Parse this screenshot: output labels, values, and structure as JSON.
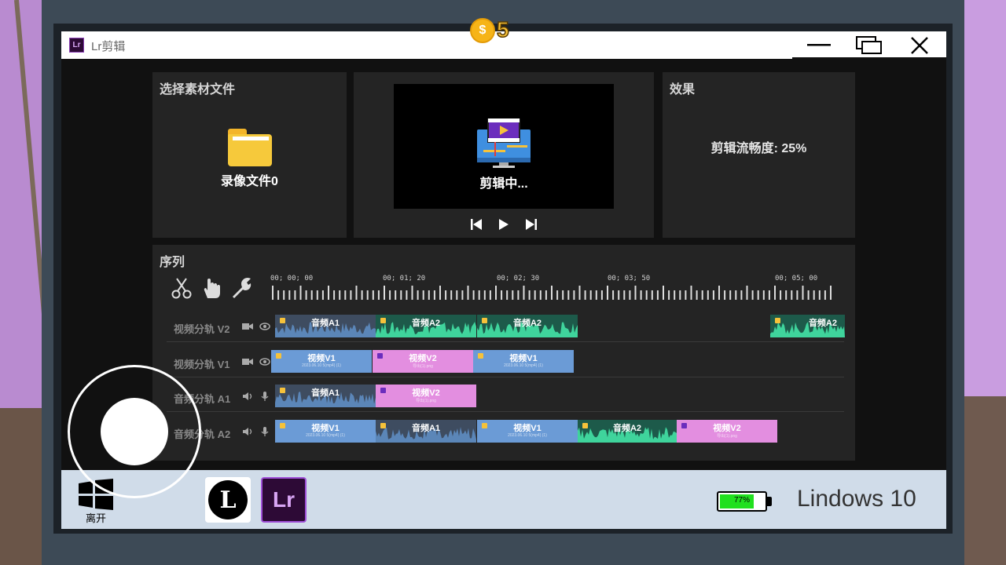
{
  "coin": {
    "count": "5",
    "symbol": "$"
  },
  "window": {
    "title": "Lr剪辑",
    "icon_text": "Lr",
    "controls": [
      "minimize-icon",
      "restore-icon",
      "close-icon"
    ]
  },
  "files_panel": {
    "title": "选择素材文件",
    "item_label": "录像文件0",
    "icon": "folder-icon"
  },
  "preview_panel": {
    "status": "剪辑中...",
    "icon": "editing-monitor-icon",
    "controls": [
      "skip-back-icon",
      "play-icon",
      "skip-forward-icon"
    ]
  },
  "effect_panel": {
    "title": "效果",
    "smoothness": "剪辑流畅度: 25%"
  },
  "sequence": {
    "title": "序列",
    "tools": [
      "scissors-icon",
      "hand-icon",
      "wrench-icon"
    ],
    "timecodes": [
      "00; 00; 00",
      "00; 01; 20",
      "00; 02; 30",
      "00; 03; 50",
      "00; 05; 00"
    ],
    "tracks": [
      {
        "label": "视频分轨 V2",
        "icons": [
          "camera-icon",
          "eye-icon"
        ],
        "clips": [
          {
            "title": "音频A1",
            "sub": "",
            "kind": "audio-blue"
          },
          {
            "title": "音频A2",
            "sub": "",
            "kind": "audio-green"
          },
          {
            "title": "音频A2",
            "sub": "",
            "kind": "audio-green"
          },
          {
            "title": "音频A2",
            "sub": "",
            "kind": "audio-green"
          }
        ]
      },
      {
        "label": "视频分轨 V1",
        "icons": [
          "camera-icon",
          "eye-icon"
        ],
        "clips": [
          {
            "title": "视频V1",
            "sub": "2023.06.10 5(mp4) (1)",
            "kind": "video-blue"
          },
          {
            "title": "视频V2",
            "sub": "导出(1).png",
            "kind": "video-pink"
          },
          {
            "title": "视频V1",
            "sub": "2023.06.10 5(mp4) (1)",
            "kind": "video-blue"
          }
        ]
      },
      {
        "label": "音频分轨 A1",
        "icons": [
          "speaker-icon",
          "mic-icon"
        ],
        "clips": [
          {
            "title": "音频A1",
            "sub": "",
            "kind": "audio-blue"
          },
          {
            "title": "视频V2",
            "sub": "导出(1).png",
            "kind": "video-pink"
          }
        ]
      },
      {
        "label": "音频分轨 A2",
        "icons": [
          "speaker-icon",
          "mic-icon"
        ],
        "clips": [
          {
            "title": "视频V1",
            "sub": "2023.06.10 5(mp4) (1)",
            "kind": "video-blue"
          },
          {
            "title": "音频A1",
            "sub": "",
            "kind": "audio-blue"
          },
          {
            "title": "视频V1",
            "sub": "2023.06.10 5(mp4) (1)",
            "kind": "video-blue"
          },
          {
            "title": "音频A2",
            "sub": "",
            "kind": "audio-green"
          },
          {
            "title": "视频V2",
            "sub": "导出(1).png",
            "kind": "video-pink"
          }
        ]
      }
    ]
  },
  "taskbar": {
    "start_label": "离开",
    "apps": [
      {
        "name": "L",
        "icon": "l-app-icon"
      },
      {
        "name": "Lr",
        "icon": "lr-app-icon"
      }
    ],
    "battery": {
      "percent_text": "77%",
      "level": 0.77
    },
    "os_name": "Lindows 10"
  },
  "colors": {
    "audio_blue": "#5b86b8",
    "audio_green": "#1f9e78",
    "video_blue": "#6b9bd6",
    "video_pink": "#e38ee0",
    "battery_green": "#21e01f",
    "taskbar": "#d0dce9"
  }
}
